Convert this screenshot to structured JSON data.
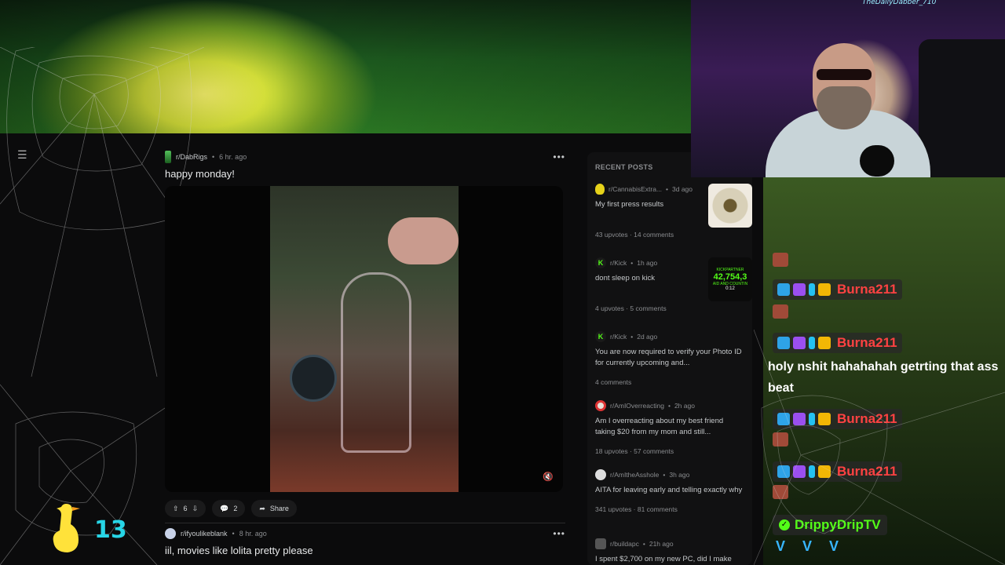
{
  "overlay": {
    "cam_tag": "TheDailyDabber_710",
    "chat": {
      "messages": [
        {
          "user": "Burna211",
          "text": ""
        },
        {
          "user": "Burna211",
          "text": "holy nshit hahahahah getrting that ass beat"
        },
        {
          "user": "Burna211",
          "text": ""
        },
        {
          "user": "Burna211",
          "text": ""
        }
      ],
      "last_user": "DrippyDripTV"
    },
    "goose_count": "13"
  },
  "feed": {
    "post1": {
      "subreddit": "r/DabRigs",
      "time": "6 hr. ago",
      "title": "happy monday!",
      "upvotes": "6",
      "comments": "2",
      "share": "Share"
    },
    "post2": {
      "subreddit": "r/ifyoulikeblank",
      "time": "8 hr. ago",
      "title": "iil, movies like lolita pretty please"
    }
  },
  "recent": {
    "heading": "RECENT POSTS",
    "items": [
      {
        "sub": "r/CannabisExtra...",
        "time": "3d ago",
        "title": "My first press results",
        "stats": "43 upvotes · 14 comments"
      },
      {
        "sub": "r/Kick",
        "time": "1h ago",
        "title": "dont sleep on kick",
        "stats": "4 upvotes · 5 comments",
        "thumb_top": "KICKPARTNER",
        "thumb_num": "42,754,3",
        "thumb_sub": "AID AND COUNTIN",
        "thumb_time": "0:12"
      },
      {
        "sub": "r/Kick",
        "time": "2d ago",
        "title": "You are now required to verify your Photo ID for currently upcoming and...",
        "stats": "4 comments"
      },
      {
        "sub": "r/AmIOverreacting",
        "time": "2h ago",
        "title": "Am I overreacting about my best friend taking $20 from my mom and still...",
        "stats": "18 upvotes · 57 comments"
      },
      {
        "sub": "r/AmItheAsshole",
        "time": "3h ago",
        "title": "AITA for leaving early and telling exactly why",
        "stats": "341 upvotes · 81 comments"
      },
      {
        "sub": "r/buildapc",
        "time": "21h ago",
        "title": "I spent $2,700 on my new PC, did I make",
        "stats": ""
      }
    ]
  }
}
